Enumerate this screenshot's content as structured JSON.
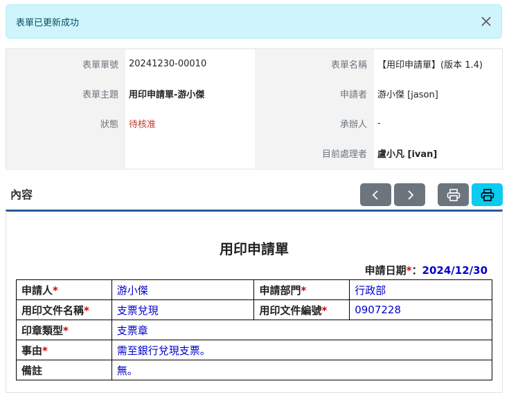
{
  "alert": {
    "message": "表單已更新成功"
  },
  "meta": {
    "form_no_label": "表單單號",
    "form_no": "20241230-00010",
    "form_name_label": "表單名稱",
    "form_name": "【用印申請單】(版本 1.4)",
    "subject_label": "表單主題",
    "subject": "用印申請單-游小傑",
    "applicant_label": "申請者",
    "applicant": "游小傑 [jason]",
    "status_label": "狀態",
    "status": "待核准",
    "handler_label": "承辦人",
    "handler": "-",
    "current_label": "目前處理者",
    "current": "盧小凡 [ivan]"
  },
  "section": {
    "title": "內容"
  },
  "form": {
    "title": "用印申請單",
    "date_label": "申請日期",
    "date_star": "*",
    "date_sep": "：",
    "date_value": "2024/12/30",
    "applicant_label": "申請人",
    "applicant_value": "游小傑",
    "dept_label": "申請部門",
    "dept_value": "行政部",
    "doc_name_label": "用印文件名稱",
    "doc_name_value": "支票兌現",
    "doc_no_label": "用印文件編號",
    "doc_no_value": "0907228",
    "seal_type_label": "印章類型",
    "seal_type_value": "支票章",
    "reason_label": "事由",
    "reason_value": "需至銀行兌現支票。",
    "note_label": "備註",
    "note_value": "無。",
    "star": "*"
  },
  "colors": {
    "alert_bg": "#cff4fc",
    "status_red": "#c0392b",
    "accent_blue": "#2b579a",
    "value_blue": "#0000cc",
    "button_gray": "#6c757d",
    "button_cyan": "#0dcaf0"
  },
  "icons": [
    "close-icon",
    "chevron-left-icon",
    "chevron-right-icon",
    "printer-icon",
    "printer-icon"
  ]
}
